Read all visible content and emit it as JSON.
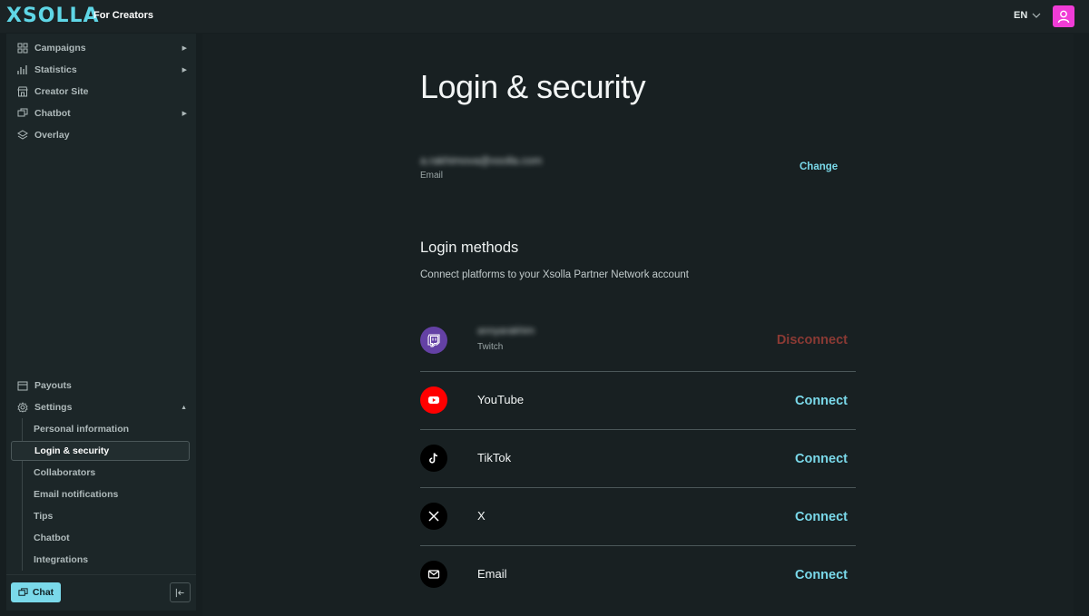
{
  "header": {
    "logo_text": "XSOLLA",
    "subtitle": "For Creators",
    "language": "EN"
  },
  "sidebar": {
    "items": [
      {
        "label": "Campaigns",
        "icon": "grid-icon",
        "has_caret": true
      },
      {
        "label": "Statistics",
        "icon": "bar-chart-icon",
        "has_caret": true
      },
      {
        "label": "Creator Site",
        "icon": "store-icon",
        "has_caret": false
      },
      {
        "label": "Chatbot",
        "icon": "chat-bubble-icon",
        "has_caret": true
      },
      {
        "label": "Overlay",
        "icon": "layers-icon",
        "has_caret": false
      }
    ],
    "payouts_label": "Payouts",
    "settings_label": "Settings",
    "settings_sub": [
      "Personal information",
      "Login & security",
      "Collaborators",
      "Email notifications",
      "Tips",
      "Chatbot",
      "Integrations"
    ],
    "active_sub": "Login & security",
    "chat_label": "Chat"
  },
  "main": {
    "title": "Login & security",
    "email_value": "a.rakhimova@xsolla.com",
    "email_label": "Email",
    "change_label": "Change",
    "methods_title": "Login methods",
    "methods_subtitle": "Connect platforms to your Xsolla Partner Network account",
    "methods": [
      {
        "name": "annyarakhim",
        "platform": "Twitch",
        "action": "Disconnect",
        "icon": "twitch-icon",
        "color": "#6441a5",
        "connected": true
      },
      {
        "name": "YouTube",
        "action": "Connect",
        "icon": "youtube-icon",
        "color": "#ff0000",
        "connected": false
      },
      {
        "name": "TikTok",
        "action": "Connect",
        "icon": "tiktok-icon",
        "color": "#000000",
        "connected": false
      },
      {
        "name": "X",
        "action": "Connect",
        "icon": "x-icon",
        "color": "#000000",
        "connected": false
      },
      {
        "name": "Email",
        "action": "Connect",
        "icon": "mail-icon",
        "color": "#000000",
        "connected": false
      }
    ]
  },
  "colors": {
    "accent": "#7ad9ea",
    "brand_pink": "#f03cd6",
    "disconnect": "#8b3a34"
  }
}
